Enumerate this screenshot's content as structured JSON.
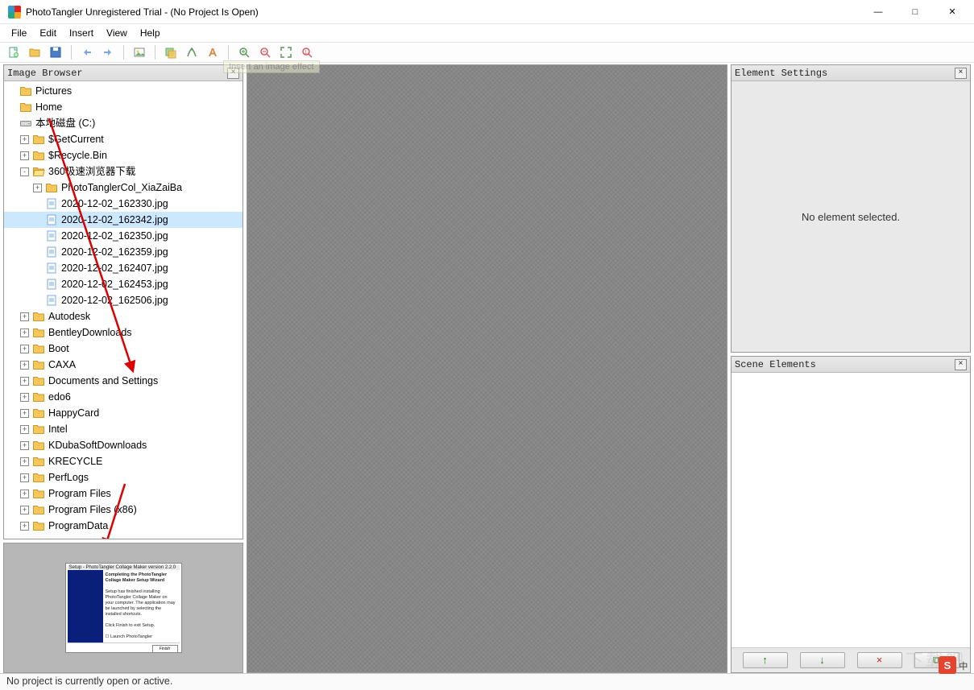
{
  "window": {
    "title": "PhotoTangler Unregistered Trial - (No Project Is Open)"
  },
  "menu": {
    "items": [
      "File",
      "Edit",
      "Insert",
      "View",
      "Help"
    ]
  },
  "tooltip_hint": "Insert an image effect",
  "panels": {
    "image_browser": {
      "title": "Image Browser"
    },
    "element_settings": {
      "title": "Element Settings",
      "empty_text": "No element selected."
    },
    "scene_elements": {
      "title": "Scene Elements"
    }
  },
  "tree": {
    "top": [
      {
        "label": "Pictures",
        "icon": "folder"
      },
      {
        "label": "Home",
        "icon": "folder"
      },
      {
        "label": "本地磁盘 (C:)",
        "icon": "drive"
      }
    ],
    "c_children": [
      {
        "label": "$GetCurrent",
        "expander": "+",
        "icon": "folder"
      },
      {
        "label": "$Recycle.Bin",
        "expander": "+",
        "icon": "folder"
      },
      {
        "label": "360极速浏览器下载",
        "expander": "-",
        "icon": "folder-open",
        "children": [
          {
            "label": "PhotoTanglerCol_XiaZaiBa",
            "expander": "+",
            "icon": "folder"
          },
          {
            "label": "2020-12-02_162330.jpg",
            "icon": "file"
          },
          {
            "label": "2020-12-02_162342.jpg",
            "icon": "file",
            "selected": true
          },
          {
            "label": "2020-12-02_162350.jpg",
            "icon": "file"
          },
          {
            "label": "2020-12-02_162359.jpg",
            "icon": "file"
          },
          {
            "label": "2020-12-02_162407.jpg",
            "icon": "file"
          },
          {
            "label": "2020-12-02_162453.jpg",
            "icon": "file"
          },
          {
            "label": "2020-12-02_162506.jpg",
            "icon": "file"
          }
        ]
      },
      {
        "label": "Autodesk",
        "expander": "+",
        "icon": "folder"
      },
      {
        "label": "BentleyDownloads",
        "expander": "+",
        "icon": "folder"
      },
      {
        "label": "Boot",
        "expander": "+",
        "icon": "folder"
      },
      {
        "label": "CAXA",
        "expander": "+",
        "icon": "folder"
      },
      {
        "label": "Documents and Settings",
        "expander": "+",
        "icon": "folder"
      },
      {
        "label": "edo6",
        "expander": "+",
        "icon": "folder"
      },
      {
        "label": "HappyCard",
        "expander": "+",
        "icon": "folder"
      },
      {
        "label": "Intel",
        "expander": "+",
        "icon": "folder"
      },
      {
        "label": "KDubaSoftDownloads",
        "expander": "+",
        "icon": "folder"
      },
      {
        "label": "KRECYCLE",
        "expander": "+",
        "icon": "folder"
      },
      {
        "label": "PerfLogs",
        "expander": "+",
        "icon": "folder"
      },
      {
        "label": "Program Files",
        "expander": "+",
        "icon": "folder"
      },
      {
        "label": "Program Files (x86)",
        "expander": "+",
        "icon": "folder"
      },
      {
        "label": "ProgramData",
        "expander": "+",
        "icon": "folder"
      }
    ]
  },
  "thumbnail": {
    "title": "Setup - PhotoTangler Collage Maker version 2.2.0",
    "heading": "Completing the PhotoTangler Collage Maker Setup Wizard",
    "body": "Setup has finished installing PhotoTangler Collage Maker on your computer. The application may be launched by selecting the installed shortcuts.",
    "prompt": "Click Finish to exit Setup.",
    "checkbox": "Launch PhotoTangler",
    "button": "Finish"
  },
  "scene_buttons": [
    "↑",
    "↓",
    "×",
    "⧉"
  ],
  "statusbar": {
    "text": "No project is currently open or active."
  },
  "watermark": "下载吧",
  "ime": {
    "badge": "S",
    "label": "中"
  }
}
